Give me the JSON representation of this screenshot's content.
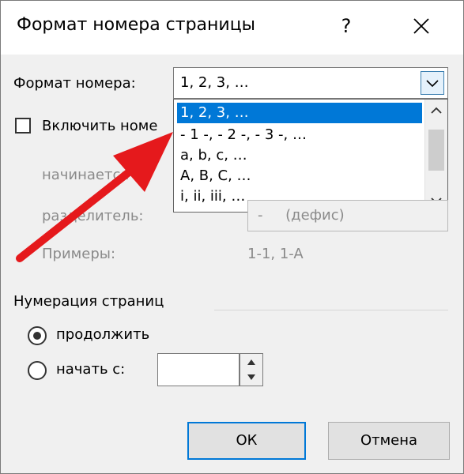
{
  "dialog": {
    "title": "Формат номера страницы",
    "help_label": "?",
    "close_icon": "close-icon"
  },
  "number_format": {
    "label": "Формат номера:",
    "selected": "1, 2, 3, …",
    "options": [
      "1, 2, 3, …",
      "- 1 -, - 2 -, - 3 -, …",
      "a, b, c, …",
      "A, B, C, …",
      "i, ii, iii, …"
    ]
  },
  "include_chapter": {
    "label": "Включить номе",
    "checked": false
  },
  "chapter_start": {
    "label": "начинается со"
  },
  "separator": {
    "label": "разделитель:",
    "value": "-     (дефис)"
  },
  "examples": {
    "label": "Примеры:",
    "value": "1-1, 1-A"
  },
  "page_numbering": {
    "section_label": "Нумерация страниц",
    "continue_label": "продолжить",
    "start_at_label": "начать с:",
    "start_at_value": "",
    "selected": "continue"
  },
  "buttons": {
    "ok": "ОК",
    "cancel": "Отмена"
  },
  "colors": {
    "selection": "#0078d7",
    "annotation_arrow": "#e5191c"
  }
}
